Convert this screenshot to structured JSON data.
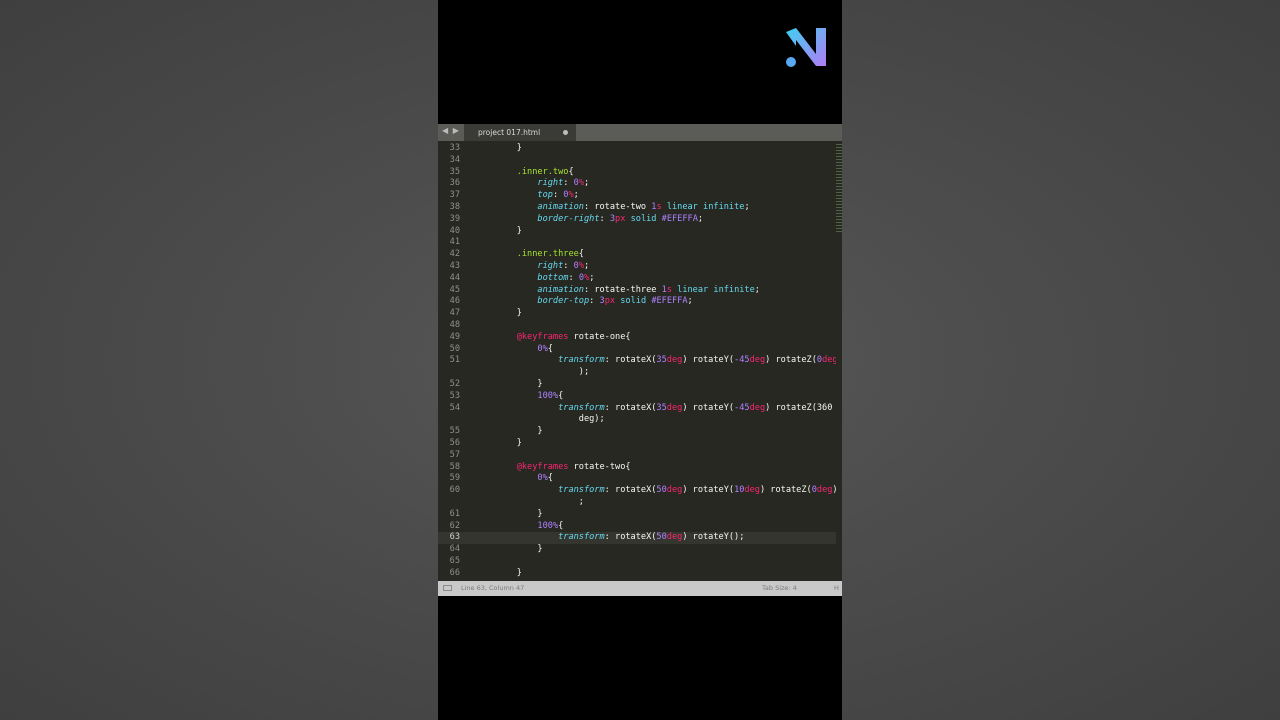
{
  "editor": {
    "tab_name": "project 017.html",
    "nav_arrows": "◀ ▶",
    "status": {
      "position": "Line 63, Column 47",
      "tab_size": "Tab Size: 4",
      "syntax": "H"
    }
  },
  "colors": {
    "background": "#272822",
    "selector": "#a6e22e",
    "property": "#66d9ef",
    "number": "#ae81ff",
    "unit": "#f92672",
    "text": "#f8f8f2"
  },
  "code_lines": [
    {
      "n": "33",
      "text": "    }"
    },
    {
      "n": "34",
      "text": ""
    },
    {
      "n": "35",
      "text": "    .inner.two{"
    },
    {
      "n": "36",
      "text": "        right: 0%;"
    },
    {
      "n": "37",
      "text": "        top: 0%;"
    },
    {
      "n": "38",
      "text": "        animation: rotate-two 1s linear infinite;"
    },
    {
      "n": "39",
      "text": "        border-right: 3px solid #EFEFFA;"
    },
    {
      "n": "40",
      "text": "    }"
    },
    {
      "n": "41",
      "text": ""
    },
    {
      "n": "42",
      "text": "    .inner.three{"
    },
    {
      "n": "43",
      "text": "        right: 0%;"
    },
    {
      "n": "44",
      "text": "        bottom: 0%;"
    },
    {
      "n": "45",
      "text": "        animation: rotate-three 1s linear infinite;"
    },
    {
      "n": "46",
      "text": "        border-top: 3px solid #EFEFFA;"
    },
    {
      "n": "47",
      "text": "    }"
    },
    {
      "n": "48",
      "text": ""
    },
    {
      "n": "49",
      "text": "    @keyframes rotate-one{"
    },
    {
      "n": "50",
      "text": "        0%{"
    },
    {
      "n": "51",
      "text": "            transform: rotateX(35deg) rotateY(-45deg) rotateZ(0deg"
    },
    {
      "n": "",
      "text": "                );"
    },
    {
      "n": "52",
      "text": "        }"
    },
    {
      "n": "53",
      "text": "        100%{"
    },
    {
      "n": "54",
      "text": "            transform: rotateX(35deg) rotateY(-45deg) rotateZ(360"
    },
    {
      "n": "",
      "text": "                deg);"
    },
    {
      "n": "55",
      "text": "        }"
    },
    {
      "n": "56",
      "text": "    }"
    },
    {
      "n": "57",
      "text": ""
    },
    {
      "n": "58",
      "text": "    @keyframes rotate-two{"
    },
    {
      "n": "59",
      "text": "        0%{"
    },
    {
      "n": "60",
      "text": "            transform: rotateX(50deg) rotateY(10deg) rotateZ(0deg)"
    },
    {
      "n": "",
      "text": "                ;"
    },
    {
      "n": "61",
      "text": "        }"
    },
    {
      "n": "62",
      "text": "        100%{"
    },
    {
      "n": "63",
      "text": "            transform: rotateX(50deg) rotateY();",
      "current": true
    },
    {
      "n": "64",
      "text": "        }"
    },
    {
      "n": "65",
      "text": ""
    },
    {
      "n": "66",
      "text": "    }"
    }
  ]
}
